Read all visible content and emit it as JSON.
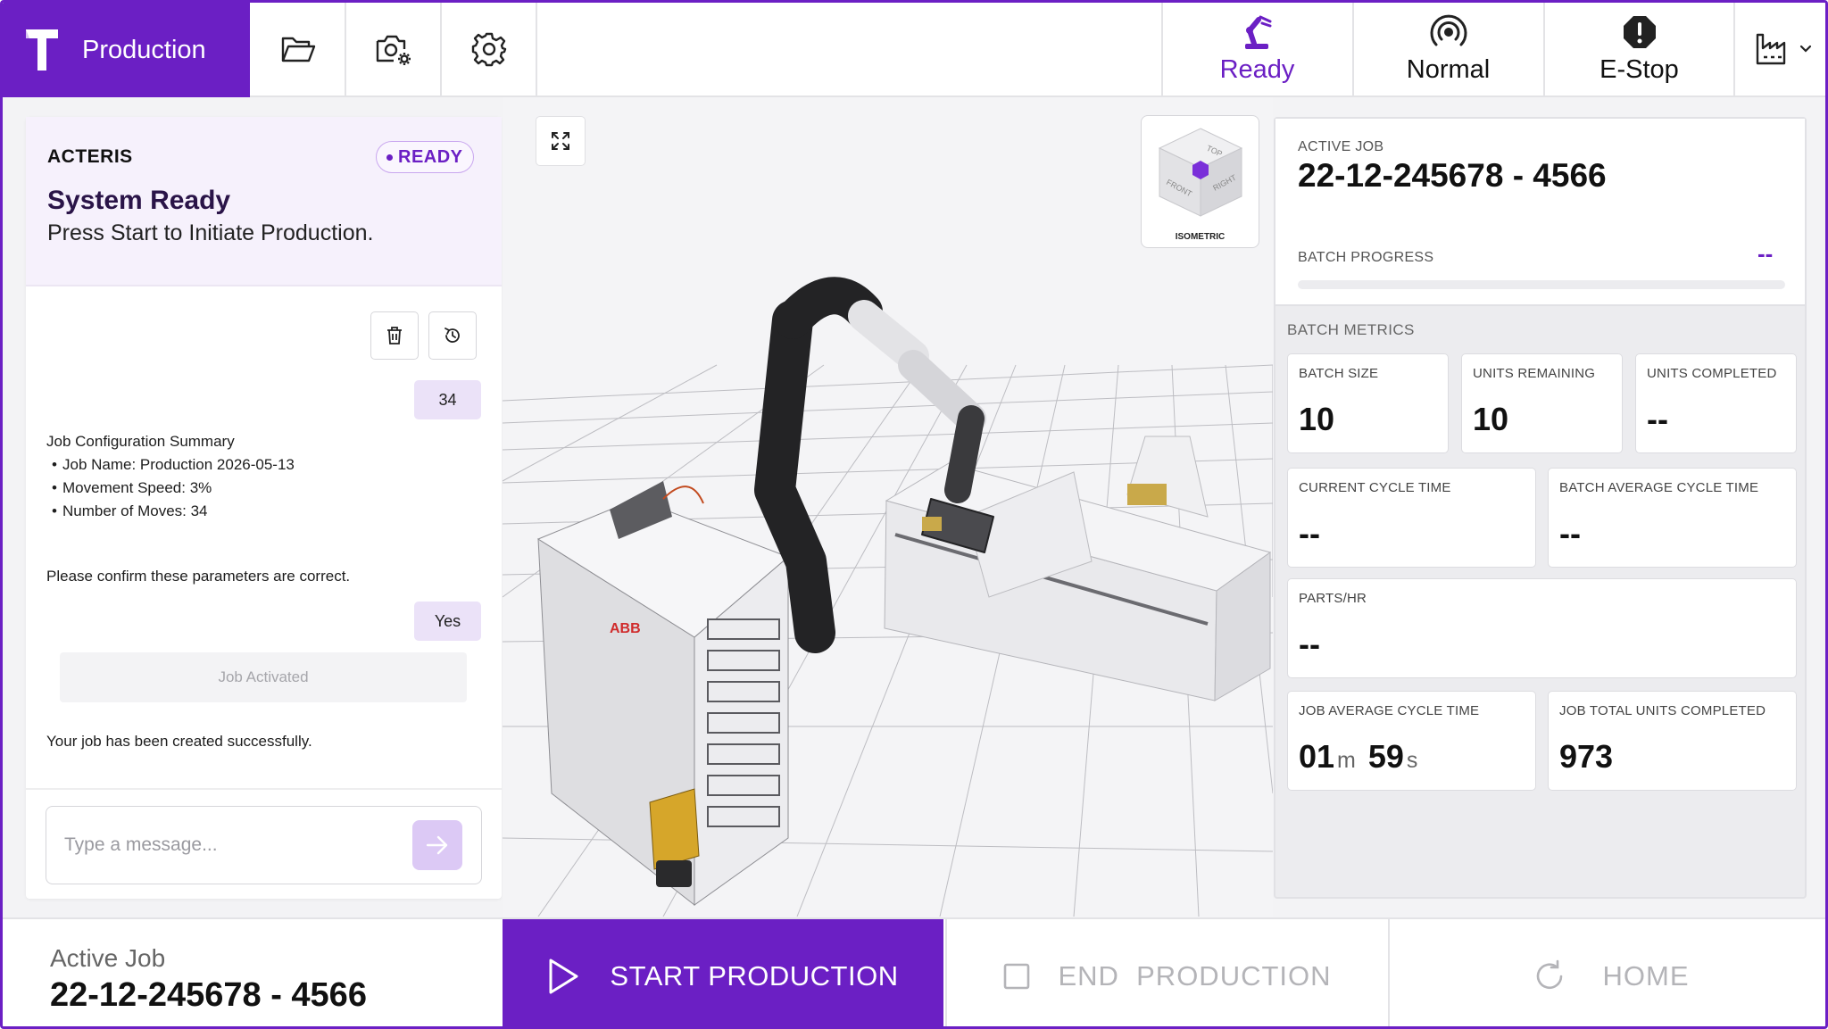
{
  "colors": {
    "accent": "#6b1fc4",
    "accent_light": "#ebe2f8",
    "disabled_text": "#b4b4b8"
  },
  "brand": {
    "title": "Production",
    "logo_icon": "t-logo-icon"
  },
  "toolbar": {
    "icons": [
      "folder-icon",
      "camera-settings-icon",
      "gear-icon"
    ]
  },
  "status": {
    "ready": {
      "label": "Ready",
      "icon": "robot-arm-icon"
    },
    "normal": {
      "label": "Normal",
      "icon": "signal-icon"
    },
    "estop": {
      "label": "E-Stop",
      "icon": "alert-octagon-icon"
    },
    "factory": {
      "icon": "factory-icon"
    }
  },
  "chat": {
    "agent_name": "ACTERIS",
    "badge": "READY",
    "title": "System Ready",
    "subtitle": "Press Start to Initiate Production.",
    "user_reply_1": "34",
    "summary_title": "Job Configuration Summary",
    "summary_items": [
      "Job Name: Production 2026-05-13",
      "Movement Speed: 3%",
      "Number of Moves: 34"
    ],
    "confirm_text": "Please confirm these parameters are correct.",
    "user_reply_2": "Yes",
    "job_activated": "Job Activated",
    "success_text": "Your job has been created successfully.",
    "input_placeholder": "Type a message..."
  },
  "viewport": {
    "view_label": "ISOMETRIC",
    "cube_faces": [
      "TOP",
      "FRONT",
      "RIGHT"
    ]
  },
  "metrics": {
    "active_job_label": "ACTIVE JOB",
    "active_job_value": "22-12-245678 - 4566",
    "batch_progress_label": "BATCH PROGRESS",
    "batch_progress_value": "--",
    "batch_progress_fraction": 0,
    "batch_metrics_label": "BATCH METRICS",
    "batch_size": {
      "label": "BATCH SIZE",
      "value": "10"
    },
    "units_remaining": {
      "label": "UNITS REMAINING",
      "value": "10"
    },
    "units_completed": {
      "label": "UNITS COMPLETED",
      "value": "--"
    },
    "current_cycle_time": {
      "label": "CURRENT CYCLE TIME",
      "value": "--"
    },
    "batch_avg_cycle_time": {
      "label": "BATCH AVERAGE CYCLE TIME",
      "value": "--"
    },
    "parts_hr": {
      "label": "PARTS/HR",
      "value": "--"
    },
    "job_avg_cycle_time": {
      "label": "JOB AVERAGE CYCLE TIME",
      "minutes": "01",
      "minutes_unit": "m",
      "seconds": "59",
      "seconds_unit": "s"
    },
    "job_total_units": {
      "label": "JOB TOTAL UNITS COMPLETED",
      "value": "973"
    }
  },
  "bottom": {
    "active_job_label": "Active Job",
    "active_job_value": "22-12-245678 - 4566",
    "start_label": "START PRODUCTION",
    "end_label": "END  PRODUCTION",
    "home_label": "HOME"
  }
}
